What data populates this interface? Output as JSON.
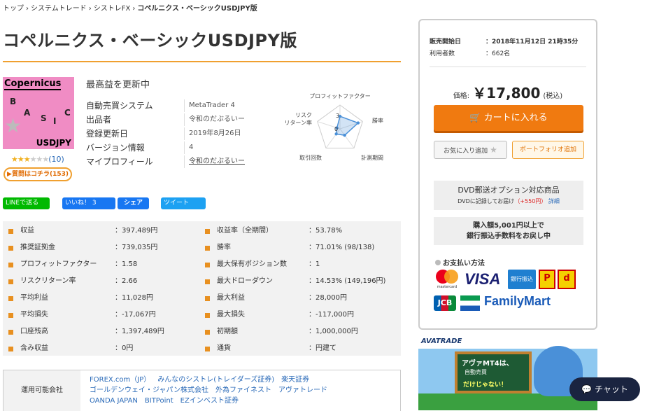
{
  "breadcrumb": {
    "items": [
      "トップ",
      "システムトレード",
      "シストレFX"
    ],
    "current": "コペルニクス・ベーシックUSDJPY版",
    "sep": "›"
  },
  "page_title": "コペルニクス・ベーシックUSDJPY版",
  "thumbnail": {
    "line1": "Copernicus",
    "letters": [
      "B",
      "A",
      "S",
      "I",
      "C"
    ],
    "line3": "USDJPY",
    "icon": "star-icon"
  },
  "rating": {
    "stars_filled": 3,
    "stars_total": 6,
    "count": "(10)"
  },
  "question_button": "▶質問はコチラ(153)",
  "headline": "最高益を更新中",
  "info": [
    {
      "key": "自動売買システム",
      "value": "MetaTrader 4"
    },
    {
      "key": "出品者",
      "value": "令和のだぶるいー"
    },
    {
      "key": "登録更新日",
      "value": "2019年8月26日"
    },
    {
      "key": "バージョン情報",
      "value": "4"
    },
    {
      "key": "マイプロフィール",
      "value": "令和のだぶるいー"
    }
  ],
  "radar": {
    "axes": [
      "プロフィットファクター",
      "勝率",
      "計測期間",
      "取引回数",
      "リスク\nリターン率"
    ],
    "tick_labels": [
      "3",
      "0"
    ],
    "values": [
      1.58,
      2.4,
      1.0,
      0.8,
      0.4
    ],
    "max": 3
  },
  "social": {
    "line": "LINEで送る",
    "fb_like": "いいね！ 3",
    "fb_share": "シェア",
    "tweet": "ツイート"
  },
  "stats_left": [
    {
      "key": "収益",
      "value": "：397,489円"
    },
    {
      "key": "推奨証拠金",
      "value": "：739,035円"
    },
    {
      "key": "プロフィットファクター",
      "value": "：1.58"
    },
    {
      "key": "リスクリターン率",
      "value": "：2.66"
    },
    {
      "key": "平均利益",
      "value": "：11,028円"
    },
    {
      "key": "平均損失",
      "value": "：-17,067円"
    },
    {
      "key": "口座残高",
      "value": "：1,397,489円"
    },
    {
      "key": "含み収益",
      "value": "：0円"
    }
  ],
  "stats_right": [
    {
      "key": "収益率（全期間）",
      "value": "：53.78%"
    },
    {
      "key": "勝率",
      "value": "：71.01% (98/138)"
    },
    {
      "key": "最大保有ポジション数",
      "value": "：1"
    },
    {
      "key": "最大ドローダウン",
      "value": "：14.53% (149,196円)"
    },
    {
      "key": "最大利益",
      "value": "：28,000円"
    },
    {
      "key": "最大損失",
      "value": "：-117,000円"
    },
    {
      "key": "初期額",
      "value": "：1,000,000円"
    },
    {
      "key": "通貨",
      "value": "：円建て"
    }
  ],
  "brokers": {
    "label": "運用可能会社",
    "items": [
      "FOREX.com（JP）",
      "みんなのシストレ(トレイダーズ証券)",
      "楽天証券",
      "ゴールデンウェイ・ジャパン株式会社",
      "外為ファイネスト",
      "アヴァトレード",
      "OANDA JAPAN",
      "BITPoint",
      "EZインベスト証券"
    ]
  },
  "sidebar": {
    "release_label": "販売開始日",
    "release_value": "：2018年11月12日 21時35分",
    "users_label": "利用者数",
    "users_value": "：662名",
    "price_label": "価格:",
    "price_value": "￥17,800",
    "tax_label": "(税込)",
    "cart_button": "カートに入れる",
    "favorite_button": "お気に入り追加",
    "portfolio_button": "ポートフォリオ追加",
    "dvd_title": "DVD郵送オプション対応商品",
    "dvd_desc": "DVDに記録してお届け",
    "dvd_price": "（+550円）",
    "dvd_link": "詳細",
    "bank_line1": "購入額5,001円以上で",
    "bank_line2": "銀行振込手数料をお戻し中",
    "payment_title": "お支払い方法",
    "payment_logos": [
      "mastercard",
      "VISA",
      "銀行振込",
      "Pay-easy",
      "d払い",
      "JCB",
      "FamilyMart"
    ]
  },
  "banner": {
    "brand": "AVATRADE",
    "line1": "アヴァMT4は、",
    "line2": "自動売買",
    "line3": "だけじゃない！"
  },
  "chat": "チャット",
  "colors": {
    "accent": "#f0a030",
    "cart": "#f07a10",
    "link": "#2a6ab8",
    "thumb": "#f08cc4"
  }
}
